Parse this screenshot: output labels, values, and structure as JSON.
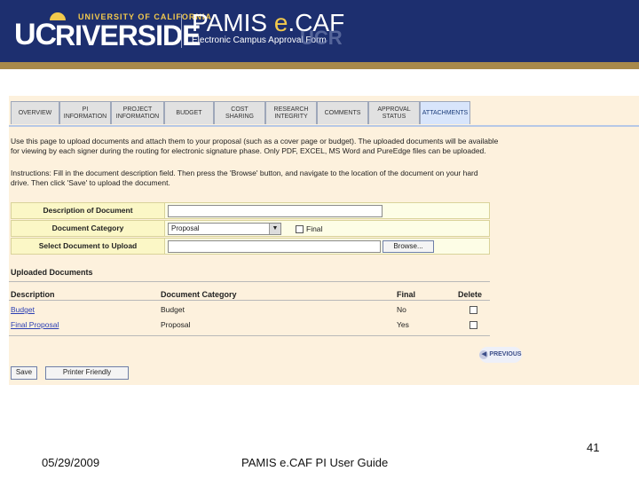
{
  "banner": {
    "university_line": "UNIVERSITY OF CALIFORNIA",
    "uc": "UC",
    "riverside": "RIVERSIDE",
    "app_name_prefix": "PAMIS ",
    "app_name_e": "e",
    "app_name_suffix": ".CAF",
    "app_subtitle": "Electronic Campus Approval Form",
    "watermark": "UCR",
    "colors": {
      "navy": "#1d2f6f",
      "gold": "#f2c94c"
    }
  },
  "tabs": [
    {
      "label": "OVERVIEW",
      "line2": ""
    },
    {
      "label": "PI",
      "line2": "INFORMATION"
    },
    {
      "label": "PROJECT",
      "line2": "INFORMATION"
    },
    {
      "label": "BUDGET",
      "line2": ""
    },
    {
      "label": "COST",
      "line2": "SHARING"
    },
    {
      "label": "RESEARCH",
      "line2": "INTEGRITY"
    },
    {
      "label": "COMMENTS",
      "line2": ""
    },
    {
      "label": "APPROVAL",
      "line2": "STATUS"
    },
    {
      "label": "ATTACHMENTS",
      "line2": ""
    }
  ],
  "intro": {
    "line1": "Use this page to upload documents and attach them to your proposal (such as a cover page or budget). The uploaded documents will be available",
    "line2": "for viewing by each signer during the routing for electronic signature phase. Only PDF, EXCEL, MS Word and PureEdge files can be uploaded.",
    "line3": "Instructions: Fill in the document description field. Then press the 'Browse' button, and navigate to the location of the document on your hard",
    "line4": "drive. Then click 'Save' to upload the document."
  },
  "form": {
    "description_label": "Description of Document",
    "description_value": "",
    "category_label": "Document Category",
    "category_value": "Proposal",
    "final_label": "Final",
    "final_checked": false,
    "select_label": "Select Document to Upload",
    "file_value": "",
    "browse_label": "Browse..."
  },
  "uploaded": {
    "title": "Uploaded Documents",
    "headers": {
      "description": "Description",
      "category": "Document Category",
      "final": "Final",
      "delete": "Delete"
    },
    "rows": [
      {
        "description": "Budget",
        "category": "Budget",
        "final": "No"
      },
      {
        "description": "Final Proposal",
        "category": "Proposal",
        "final": "Yes"
      }
    ]
  },
  "nav": {
    "previous_label": "PREVIOUS"
  },
  "actions": {
    "save_label": "Save",
    "printer_label": "Printer Friendly"
  },
  "footer": {
    "date": "05/29/2009",
    "title": "PAMIS e.CAF PI User Guide",
    "page": "41"
  }
}
